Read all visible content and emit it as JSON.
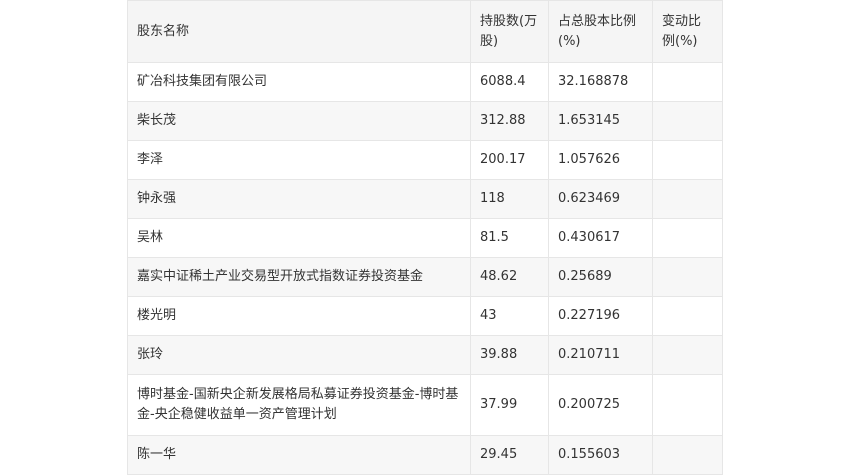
{
  "table": {
    "headers": [
      "股东名称",
      "持股数(万股)",
      "占总股本比例(%)",
      "变动比例(%)"
    ],
    "rows": [
      {
        "name": "矿冶科技集团有限公司",
        "shares": "6088.4",
        "ratio": "32.168878",
        "change": ""
      },
      {
        "name": "柴长茂",
        "shares": "312.88",
        "ratio": "1.653145",
        "change": ""
      },
      {
        "name": "李泽",
        "shares": "200.17",
        "ratio": "1.057626",
        "change": ""
      },
      {
        "name": "钟永强",
        "shares": "118",
        "ratio": "0.623469",
        "change": ""
      },
      {
        "name": "吴林",
        "shares": "81.5",
        "ratio": "0.430617",
        "change": ""
      },
      {
        "name": "嘉实中证稀土产业交易型开放式指数证券投资基金",
        "shares": "48.62",
        "ratio": "0.25689",
        "change": ""
      },
      {
        "name": "楼光明",
        "shares": "43",
        "ratio": "0.227196",
        "change": ""
      },
      {
        "name": "张玲",
        "shares": "39.88",
        "ratio": "0.210711",
        "change": ""
      },
      {
        "name": "博时基金-国新央企新发展格局私募证券投资基金-博时基金-央企稳健收益单一资产管理计划",
        "shares": "37.99",
        "ratio": "0.200725",
        "change": ""
      },
      {
        "name": "陈一华",
        "shares": "29.45",
        "ratio": "0.155603",
        "change": ""
      }
    ]
  }
}
